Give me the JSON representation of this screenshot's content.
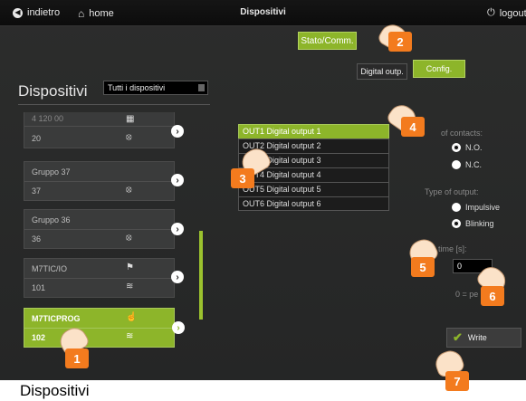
{
  "topbar": {
    "back": "indietro",
    "home": "home",
    "title": "Dispositivi",
    "logout": "logout"
  },
  "buttons": {
    "stato": "Stato/Comm.",
    "digital": "Digital outp.",
    "config": "Config.",
    "write": "Write"
  },
  "panel": {
    "title": "Dispositivi",
    "filter": "Tutti i dispositivi"
  },
  "devices": [
    {
      "name": "4 120 00",
      "id": "20"
    },
    {
      "name": "Gruppo 37",
      "id": "37"
    },
    {
      "name": "Gruppo 36",
      "id": "36"
    },
    {
      "name": "M7TIC/IO",
      "id": "101"
    },
    {
      "name": "M7TICPROG",
      "id": "102"
    }
  ],
  "outputs": [
    "OUT1 Digital output 1",
    "OUT2 Digital output 2",
    "OUT3 Digital output 3",
    "OUT4 Digital output 4",
    "OUT5 Digital output 5",
    "OUT6 Digital output 6"
  ],
  "settings": {
    "contacts_label": "of contacts:",
    "no": "N.O.",
    "nc": "N.C.",
    "type_label": "Type of output:",
    "impulsive": "Impulsive",
    "blinking": "Blinking",
    "time_label": "time [s]:",
    "time_value": "0",
    "hint": "0 = pe"
  },
  "badges": [
    "1",
    "2",
    "3",
    "4",
    "5",
    "6",
    "7"
  ],
  "caption": "Dispositivi",
  "colors": {
    "accent": "#8db52a",
    "badge": "#f37b1e"
  }
}
